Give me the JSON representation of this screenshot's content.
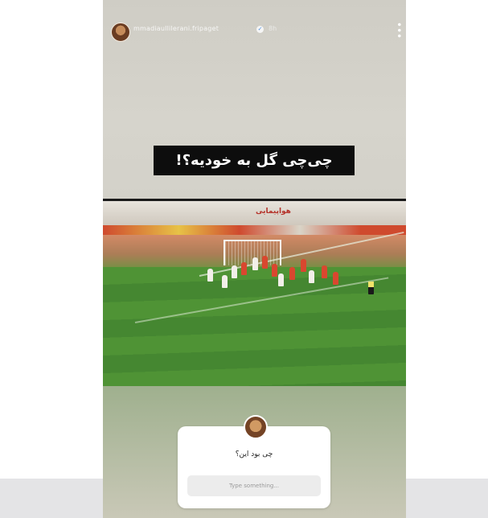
{
  "story": {
    "username": "mmadiaullilerani.fripaget",
    "timestamp": "8h",
    "caption": "چی‌چی گل به خودیه؟!",
    "video": {
      "banner_text": "هواپیمایی"
    },
    "question_sticker": {
      "question": "چی بود این؟",
      "placeholder": "Type something..."
    }
  },
  "icons": {
    "verified": "verified-badge-icon",
    "more": "more-options-icon"
  },
  "colors": {
    "caption_bg": "#0d0d0d",
    "pitch_green": "#4f9335",
    "banner_red": "#cf4a2e"
  }
}
